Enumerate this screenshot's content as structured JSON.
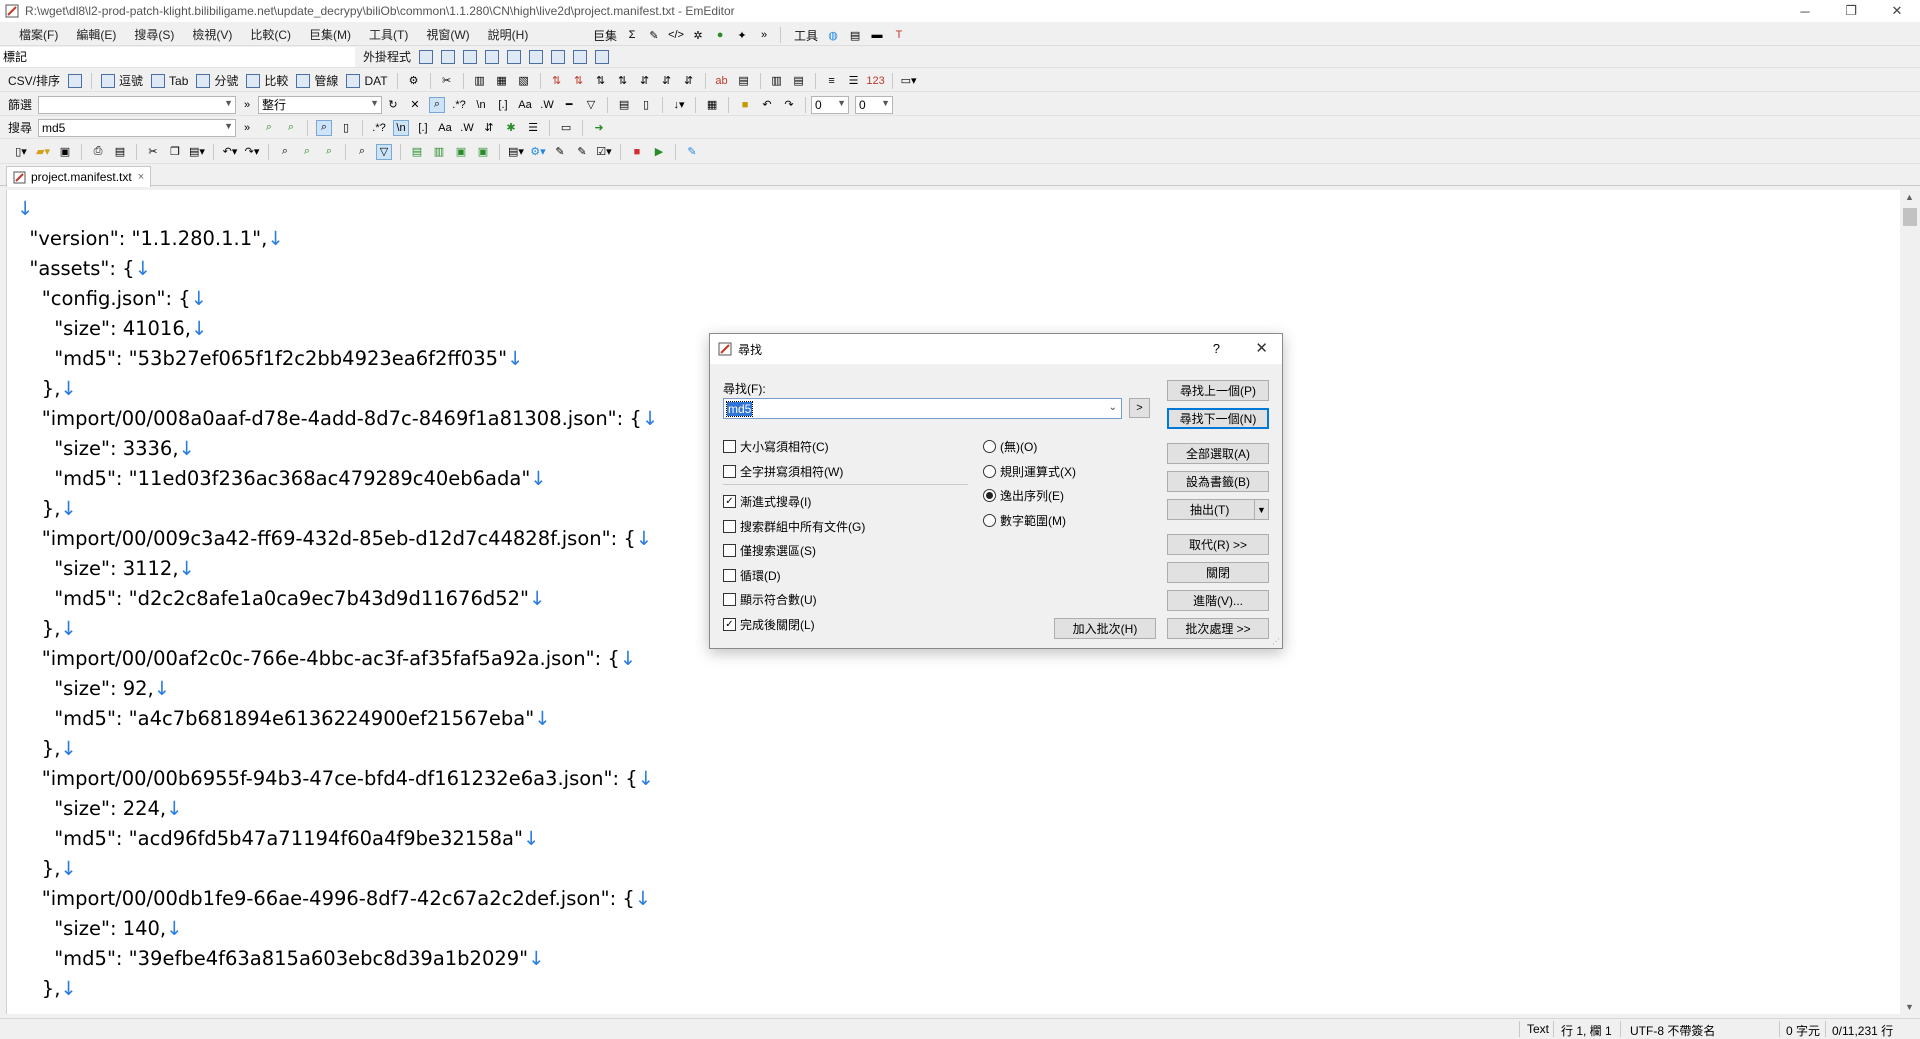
{
  "window": {
    "title": "R:\\wget\\dl8\\l2-prod-patch-klight.bilibiligame.net\\update_decrypy\\biliOb\\common\\1.1.280\\CN\\high\\live2d\\project.manifest.txt - EmEditor",
    "minimize": "─",
    "restore": "❐",
    "close": "✕"
  },
  "menu": {
    "items": [
      "檔案(F)",
      "編輯(E)",
      "搜尋(S)",
      "檢視(V)",
      "比較(C)",
      "巨集(M)",
      "工具(T)",
      "視窗(W)",
      "說明(H)"
    ],
    "macros_label": "巨集",
    "tools_label": "工具"
  },
  "toolbars": {
    "marker_label": "標記",
    "plugins_label": "外掛程式",
    "csv_label": "CSV/排序",
    "csv_modes": [
      "逗號",
      "Tab",
      "分號",
      "比較",
      "管線",
      "DAT"
    ],
    "filter_label": "篩選",
    "filter_mode": "整行",
    "number_a": "0",
    "number_b": "0",
    "search_label": "搜尋",
    "search_value": "md5"
  },
  "tab": {
    "name": "project.manifest.txt",
    "close": "×"
  },
  "editor": {
    "lines": [
      "",
      "  \"version\": \"1.1.280.1.1\",",
      "  \"assets\": {",
      "    \"config.json\": {",
      "      \"size\": 41016,",
      "      \"md5\": \"53b27ef065f1f2c2bb4923ea6f2ff035\"",
      "    },",
      "    \"import/00/008a0aaf-d78e-4add-8d7c-8469f1a81308.json\": {",
      "      \"size\": 3336,",
      "      \"md5\": \"11ed03f236ac368ac479289c40eb6ada\"",
      "    },",
      "    \"import/00/009c3a42-ff69-432d-85eb-d12d7c44828f.json\": {",
      "      \"size\": 3112,",
      "      \"md5\": \"d2c2c8afe1a0ca9ec7b43d9d11676d52\"",
      "    },",
      "    \"import/00/00af2c0c-766e-4bbc-ac3f-af35faf5a92a.json\": {",
      "      \"size\": 92,",
      "      \"md5\": \"a4c7b681894e6136224900ef21567eba\"",
      "    },",
      "    \"import/00/00b6955f-94b3-47ce-bfd4-df161232e6a3.json\": {",
      "      \"size\": 224,",
      "      \"md5\": \"acd96fd5b47a71194f60a4f9be32158a\"",
      "    },",
      "    \"import/00/00db1fe9-66ae-4996-8df7-42c67a2c2def.json\": {",
      "      \"size\": 140,",
      "      \"md5\": \"39efbe4f63a815a603ebc8d39a1b2029\"",
      "    },"
    ],
    "newline_mark": "↓"
  },
  "dialog": {
    "title": "尋找",
    "help": "?",
    "close": "✕",
    "find_label": "尋找(F):",
    "find_value": "md5",
    "expand": ">",
    "checkboxes": [
      {
        "label": "大小寫須相符(C)",
        "checked": false
      },
      {
        "label": "全字拼寫須相符(W)",
        "checked": false
      },
      {
        "label": "漸進式搜尋(I)",
        "checked": true
      },
      {
        "label": "搜索群組中所有文件(G)",
        "checked": false
      },
      {
        "label": "僅搜索選區(S)",
        "checked": false
      },
      {
        "label": "循環(D)",
        "checked": false
      },
      {
        "label": "顯示符合數(U)",
        "checked": false
      },
      {
        "label": "完成後關閉(L)",
        "checked": true
      }
    ],
    "radios": [
      {
        "label": "(無)(O)",
        "selected": false
      },
      {
        "label": "規則運算式(X)",
        "selected": false
      },
      {
        "label": "逸出序列(E)",
        "selected": true
      },
      {
        "label": "數字範圍(M)",
        "selected": false
      }
    ],
    "buttons": {
      "find_prev": "尋找上一個(P)",
      "find_next": "尋找下一個(N)",
      "select_all": "全部選取(A)",
      "bookmark": "設為書籤(B)",
      "extract": "抽出(T)",
      "replace": "取代(R) >>",
      "close": "關閉",
      "advanced": "進階(V)...",
      "add_batch": "加入批次(H)",
      "batch": "批次處理 >>"
    }
  },
  "status": {
    "mode": "Text",
    "position": "行 1, 欄 1",
    "encoding": "UTF-8 不帶簽名",
    "selection": "0 字元",
    "lines": "0/11,231 行"
  }
}
